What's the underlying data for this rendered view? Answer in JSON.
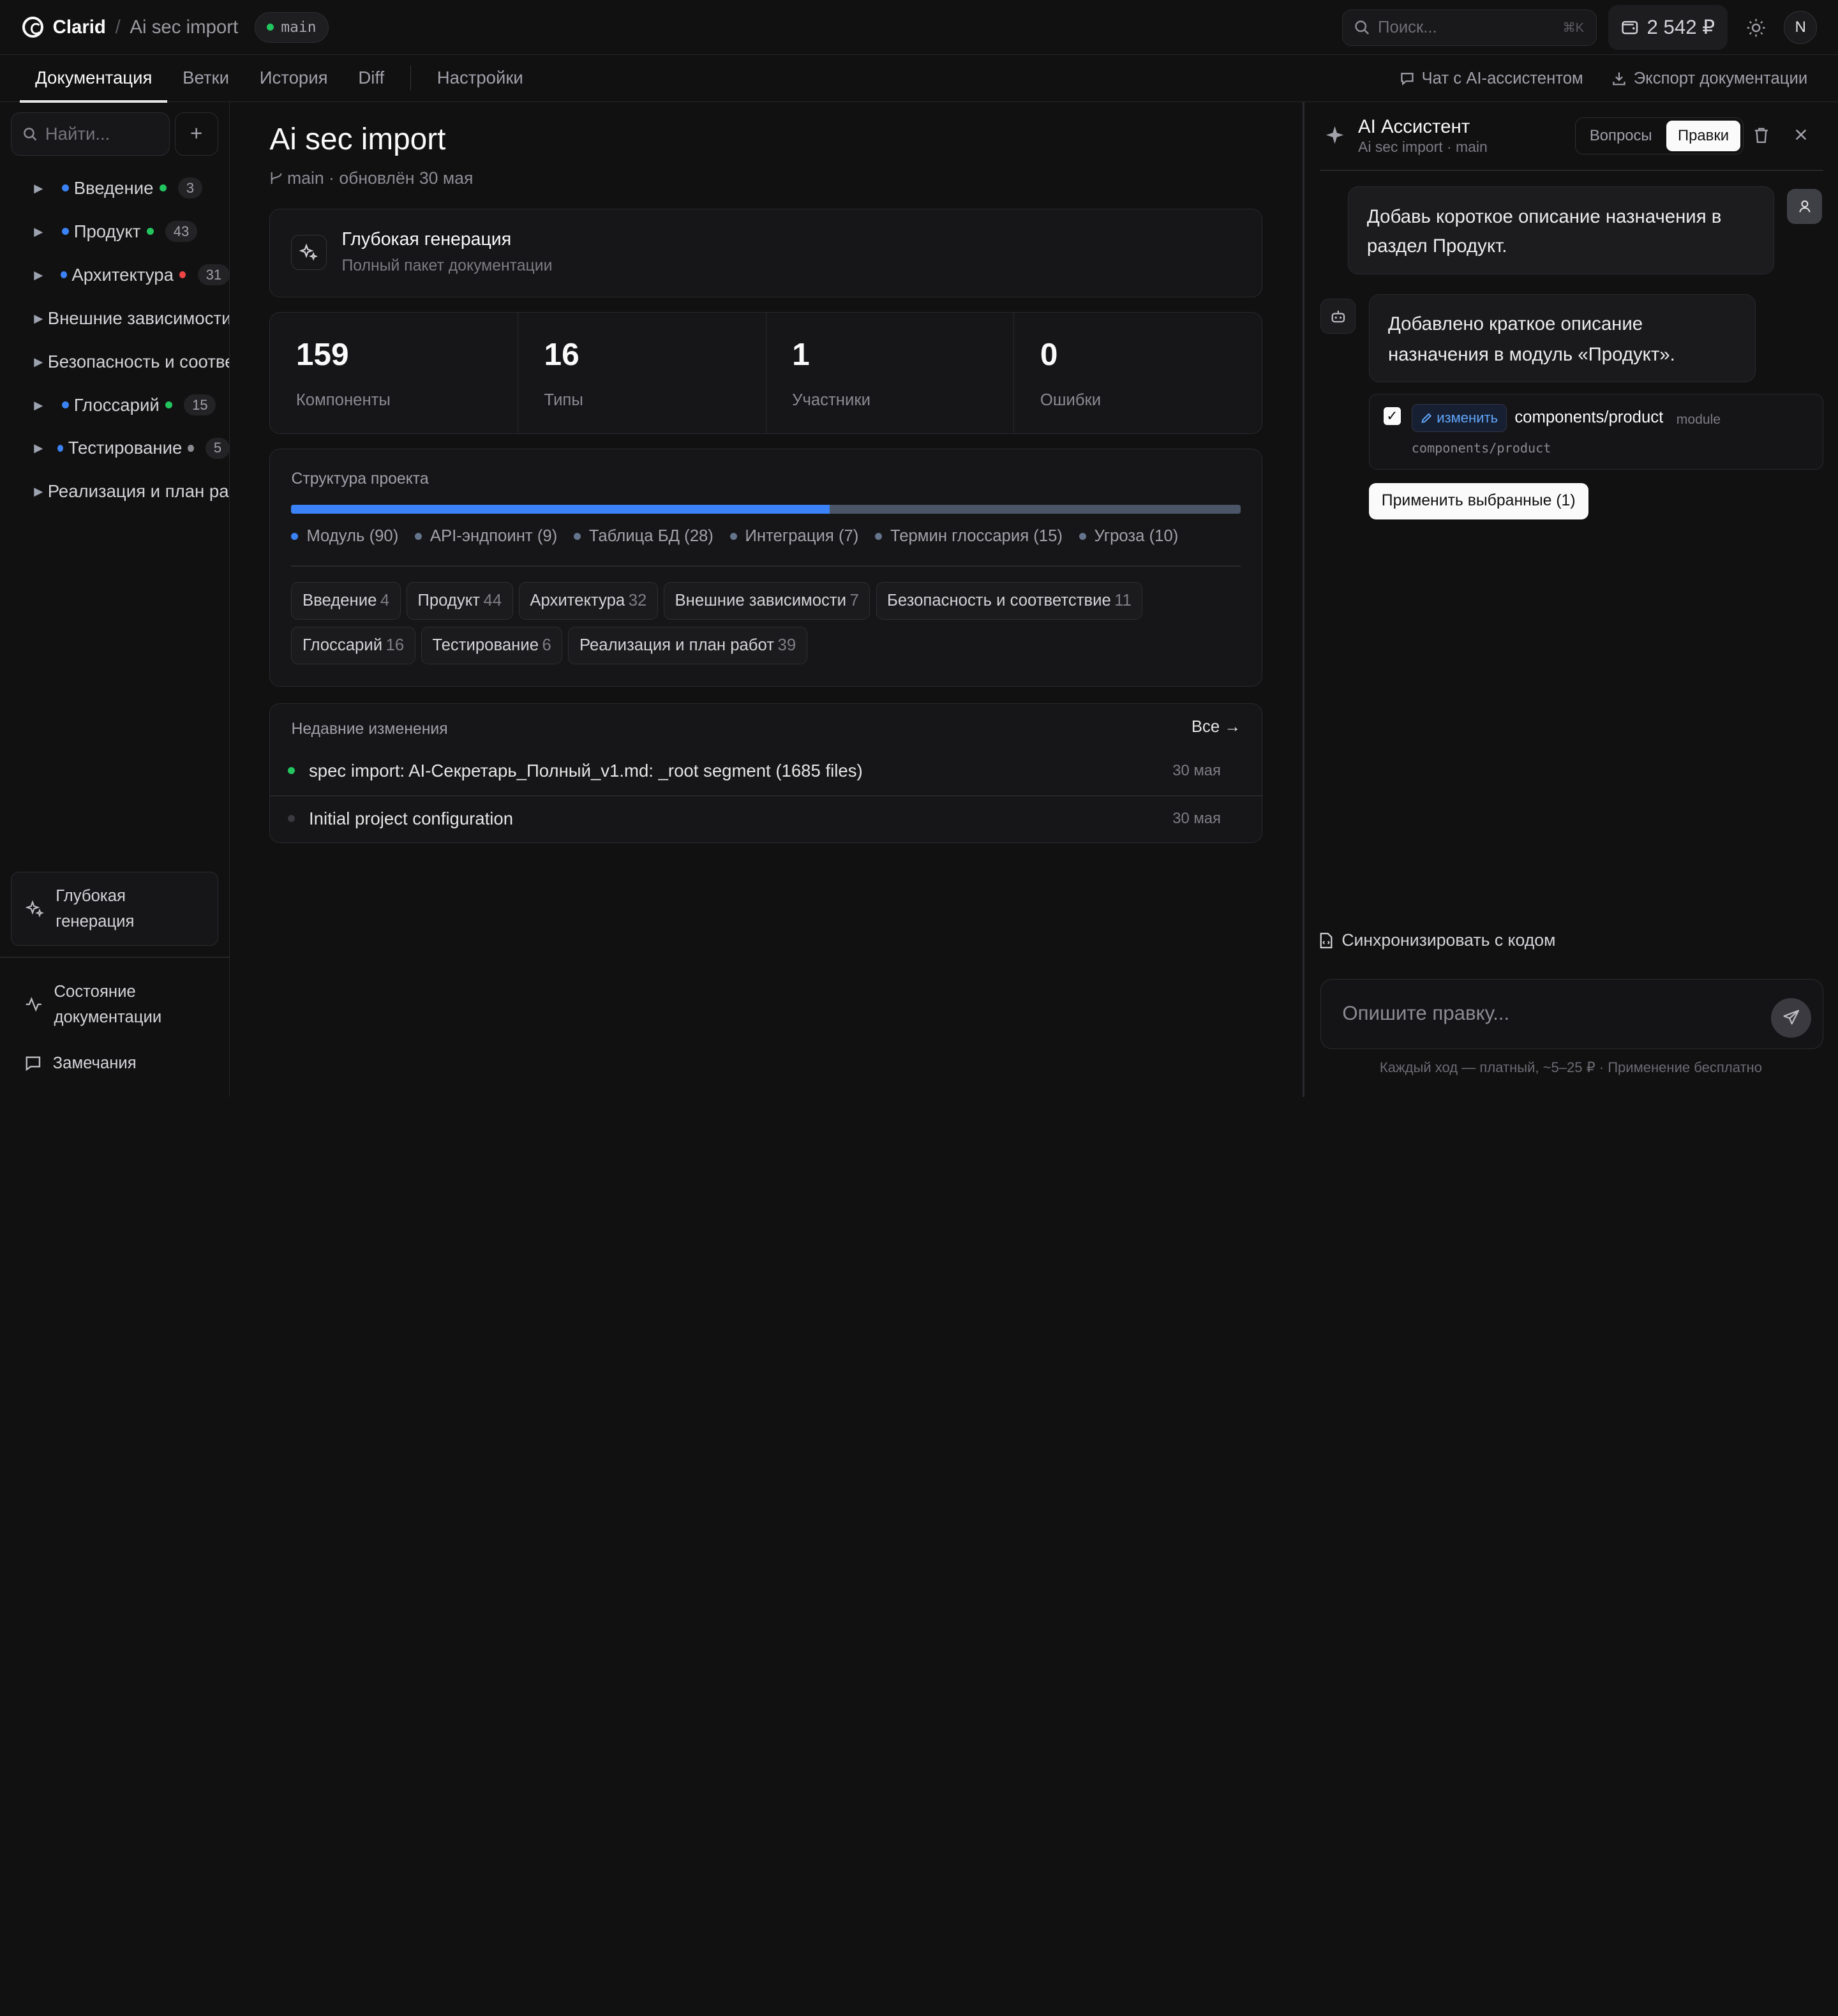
{
  "header": {
    "app_name": "Clarid",
    "separator": "/",
    "project": "Ai sec import",
    "branch": "main",
    "search_placeholder": "Поиск...",
    "search_shortcut": "⌘K",
    "balance": "2 542 ₽",
    "avatar_initial": "N"
  },
  "tabs": {
    "items": [
      {
        "label": "Документация",
        "active": true
      },
      {
        "label": "Ветки"
      },
      {
        "label": "История"
      },
      {
        "label": "Diff"
      },
      {
        "label": "Настройки"
      }
    ],
    "chat_link": "Чат с AI-ассистентом",
    "export_link": "Экспорт документации"
  },
  "sidebar": {
    "search_placeholder": "Найти...",
    "add_label": "+",
    "tree": [
      {
        "label": "Введение",
        "count": "3",
        "status": "green"
      },
      {
        "label": "Продукт",
        "count": "43",
        "status": "green"
      },
      {
        "label": "Архитектура",
        "count": "31",
        "status": "red"
      },
      {
        "label": "Внешние зависимости",
        "count": "",
        "status": ""
      },
      {
        "label": "Безопасность и соответствие",
        "count": "",
        "status": ""
      },
      {
        "label": "Глоссарий",
        "count": "15",
        "status": "green"
      },
      {
        "label": "Тестирование",
        "count": "5",
        "status": "gray"
      },
      {
        "label": "Реализация и план работ",
        "count": "",
        "status": ""
      }
    ],
    "deep_gen_line1": "Глубокая",
    "deep_gen_line2": "генерация",
    "health_line1": "Состояние",
    "health_line2": "документации",
    "remarks": "Замечания"
  },
  "main": {
    "title": "Ai sec import",
    "meta": "main · обновлён 30 мая",
    "gen_title": "Глубокая генерация",
    "gen_subtitle": "Полный пакет документации",
    "stats": [
      {
        "value": "159",
        "label": "Компоненты"
      },
      {
        "value": "16",
        "label": "Типы"
      },
      {
        "value": "1",
        "label": "Участники"
      },
      {
        "value": "0",
        "label": "Ошибки"
      }
    ],
    "structure_title": "Структура проекта",
    "structure_fill": 0.567,
    "legend": [
      {
        "label": "Модуль (90)",
        "color": "#3b82f6"
      },
      {
        "label": "API-эндпоинт (9)",
        "color": "#64748b"
      },
      {
        "label": "Таблица БД (28)",
        "color": "#64748b"
      },
      {
        "label": "Интеграция (7)",
        "color": "#64748b"
      },
      {
        "label": "Термин глоссария (15)",
        "color": "#64748b"
      },
      {
        "label": "Угроза (10)",
        "color": "#64748b"
      }
    ],
    "chips": [
      {
        "label": "Введение",
        "count": "4"
      },
      {
        "label": "Продукт",
        "count": "44"
      },
      {
        "label": "Архитектура",
        "count": "32"
      },
      {
        "label": "Внешние зависимости",
        "count": "7"
      },
      {
        "label": "Безопасность и соответствие",
        "count": "11"
      },
      {
        "label": "Глоссарий",
        "count": "16"
      },
      {
        "label": "Тестирование",
        "count": "6"
      },
      {
        "label": "Реализация и план работ",
        "count": "39"
      }
    ],
    "recent_title": "Недавние изменения",
    "recent_all": "Все →",
    "commits": [
      {
        "message": "spec import: AI-Секретарь_Полный_v1.md: _root segment (1685 files)",
        "date": "30 мая",
        "status": "green"
      },
      {
        "message": "Initial project configuration",
        "date": "30 мая",
        "status": "dim"
      }
    ]
  },
  "assistant": {
    "title": "AI Ассистент",
    "subtitle": "Ai sec import · main",
    "mode_questions": "Вопросы",
    "mode_edits": "Правки",
    "user_message": "Добавь короткое описание назначения в раздел Продукт.",
    "bot_message": "Добавлено краткое описание назначения в модуль «Продукт».",
    "change_action": "изменить",
    "change_path": "components/product",
    "change_kind": "module",
    "change_sub": "components/product",
    "apply_label": "Применить выбранные (1)",
    "sync_label": "Синхронизировать с кодом",
    "composer_placeholder": "Опишите правку...",
    "footnote": "Каждый ход — платный, ~5–25 ₽ · Применение бесплатно"
  },
  "colors": {
    "accent_blue": "#3b82f6",
    "status_green": "#22c55e",
    "status_red": "#ef4444",
    "background": "#111112"
  }
}
